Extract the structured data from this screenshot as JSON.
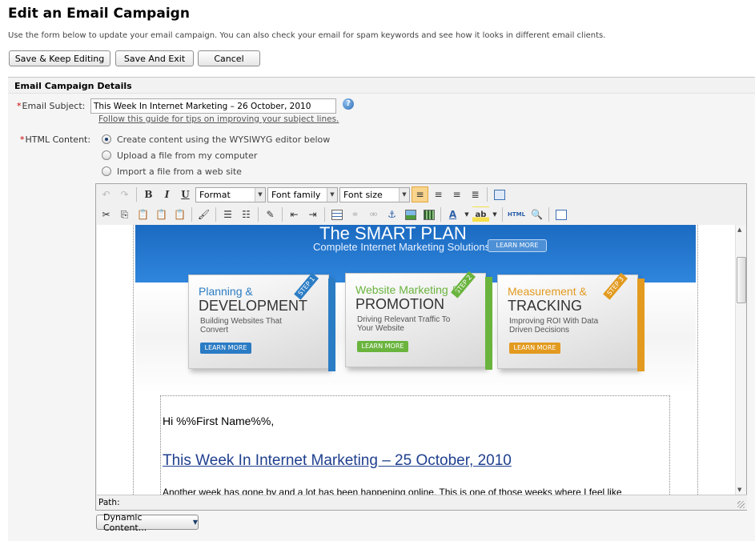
{
  "page": {
    "title": "Edit an Email Campaign",
    "intro": "Use the form below to update your email campaign. You can also check your email for spam keywords and see how it looks in different email clients."
  },
  "actions": {
    "save_keep": "Save & Keep Editing",
    "save_exit": "Save And Exit",
    "cancel": "Cancel"
  },
  "section": {
    "title": "Email Campaign Details"
  },
  "subject": {
    "required_mark": "*",
    "label": "Email Subject:",
    "value": "This Week In Internet Marketing – 26 October, 2010",
    "help_icon": "?",
    "guide_link": "Follow this guide for tips on improving your subject lines."
  },
  "content": {
    "required_mark": "*",
    "label": "HTML Content:",
    "options": [
      {
        "label": "Create content using the WYSIWYG editor below",
        "checked": true
      },
      {
        "label": "Upload a file from my computer",
        "checked": false
      },
      {
        "label": "Import a file from a web site",
        "checked": false
      }
    ]
  },
  "toolbar": {
    "format": "Format",
    "font_family": "Font family",
    "font_size": "Font size",
    "bold": "B",
    "italic": "I",
    "underline": "U",
    "html": "HTML",
    "highlight_color": "#f9d48c"
  },
  "banner": {
    "title": "The SMART PLAN",
    "subtitle": "Complete Internet Marketing Solutions",
    "learn_more": "LEARN MORE",
    "steps": [
      {
        "step": "STEP 1",
        "line1": "Planning &",
        "line2": "DEVELOPMENT",
        "desc": "Building Websites That Convert",
        "button": "LEARN MORE",
        "color": "#2a7cc4"
      },
      {
        "step": "STEP 2",
        "line1": "Website Marketing &",
        "line2": "PROMOTION",
        "desc": "Driving Relevant Traffic To Your Website",
        "button": "LEARN MORE",
        "color": "#6ab43e"
      },
      {
        "step": "STEP 3",
        "line1": "Measurement &",
        "line2": "TRACKING",
        "desc": "Improving ROI With Data Driven Decisions",
        "button": "LEARN MORE",
        "color": "#e29a1f"
      }
    ]
  },
  "email_body": {
    "greeting": "Hi %%First Name%%,",
    "headline": "This Week In Internet Marketing – 25 October, 2010",
    "paragraph": "Another week has gone by and a lot has been happening online.  This is one of those weeks where I feel like"
  },
  "editor": {
    "path_label": "Path:"
  },
  "dynamic_content": {
    "label": "Dynamic Content..."
  }
}
